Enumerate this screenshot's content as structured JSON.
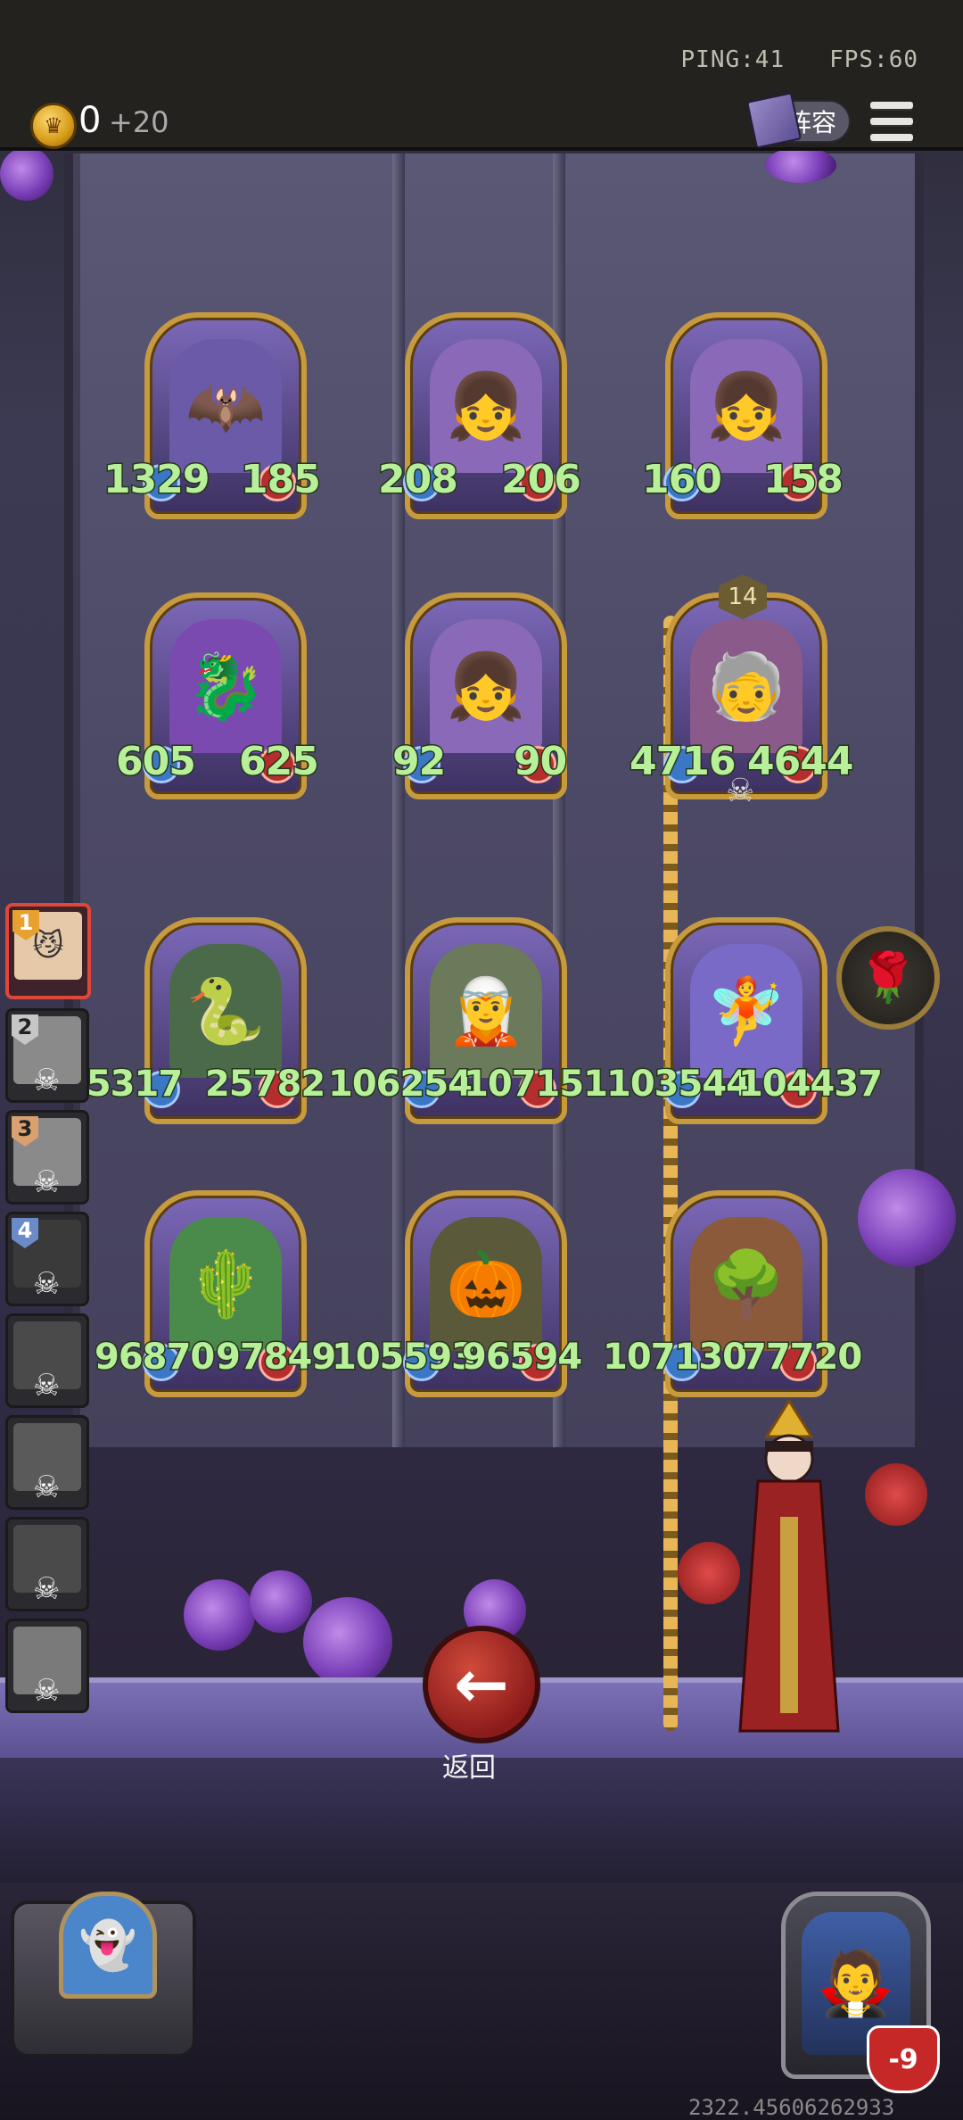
{
  "hud": {
    "ping_text": "PING:41",
    "fps_text": "FPS:60",
    "gold": "0",
    "gold_income": "+20",
    "lineup_label": "阵容",
    "icons": [
      "crown-coin-icon",
      "lineup-book-icon",
      "menu-icon"
    ]
  },
  "units": [
    {
      "id": "bat-demon",
      "atk": "1329",
      "hp": "185"
    },
    {
      "id": "doll-girl-1",
      "atk": "208",
      "hp": "206"
    },
    {
      "id": "doll-girl-2",
      "atk": "160",
      "hp": "158"
    },
    {
      "id": "horned-dragon",
      "atk": "605",
      "hp": "625"
    },
    {
      "id": "doll-girl-3",
      "atk": "92",
      "hp": "90"
    },
    {
      "id": "old-scientist",
      "atk": "4716",
      "hp": "4644",
      "level": "14"
    },
    {
      "id": "medusa",
      "atk": "25317",
      "hp": "25782"
    },
    {
      "id": "forest-elf",
      "atk": "106254",
      "hp": "107151"
    },
    {
      "id": "flower-fairy",
      "atk": "103544",
      "hp": "104437"
    },
    {
      "id": "cactus",
      "atk": "96870",
      "hp": "97849"
    },
    {
      "id": "pumpkin-monster",
      "atk": "105593",
      "hp": "96594"
    },
    {
      "id": "tree-ent",
      "atk": "107130",
      "hp": "77720"
    }
  ],
  "roster": [
    {
      "num": "1",
      "state": "active"
    },
    {
      "num": "2",
      "state": "dead"
    },
    {
      "num": "3",
      "state": "dead"
    },
    {
      "num": "4",
      "state": "dead"
    },
    {
      "num": "",
      "state": "dead"
    },
    {
      "num": "",
      "state": "dead"
    },
    {
      "num": "",
      "state": "dead"
    },
    {
      "num": "",
      "state": "dead"
    }
  ],
  "back_label": "返回",
  "hero_health": "-9",
  "coords_text": "2322.45606262933"
}
